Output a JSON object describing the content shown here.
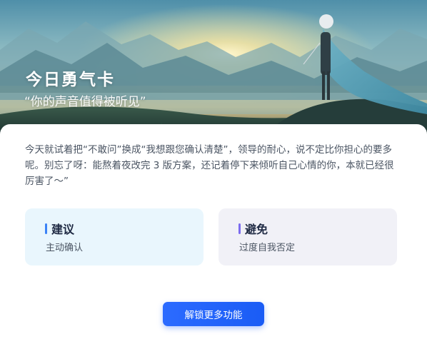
{
  "hero": {
    "title": "今日勇气卡",
    "subtitle": "“你的声音值得被听见”",
    "image": "woman-in-cape-on-mountain-at-sunrise"
  },
  "card": {
    "body": "今天就试着把“不敢问”换成“我想跟您确认清楚”，领导的耐心，说不定比你担心的要多呢。别忘了呀：能熬着夜改完 3 版方案，还记着停下来倾听自己心情的你，本就已经很厉害了～”"
  },
  "tips": {
    "do": {
      "title": "建议",
      "text": "主动确认"
    },
    "dont": {
      "title": "避免",
      "text": "过度自我否定"
    }
  },
  "actions": {
    "unlock_label": "解锁更多功能"
  },
  "colors": {
    "accent": "#2c6bff",
    "do_bg": "#e9f6fd",
    "dont_bg": "#f1f1f7",
    "do_bar": "#3b82f6",
    "dont_bar": "#7c6cf0"
  }
}
